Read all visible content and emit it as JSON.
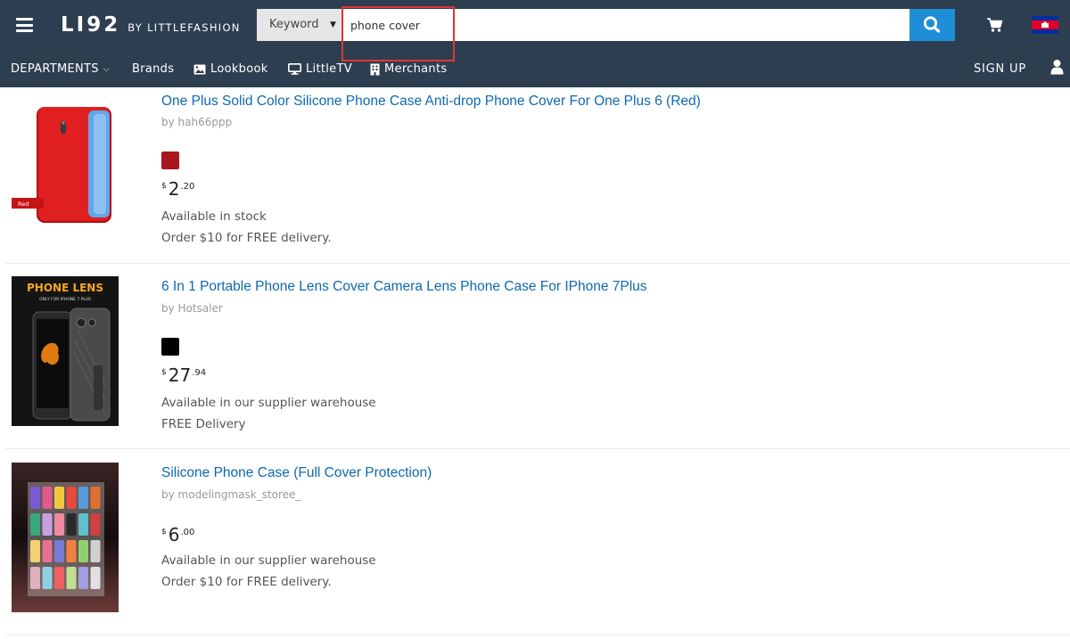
{
  "header": {
    "logo_main": "LI92",
    "logo_sub": "BY LITTLEFASHION",
    "search": {
      "scope_label": "Keyword",
      "query": "phone cover"
    },
    "flag": "cambodia-flag"
  },
  "nav": {
    "departments": "DEPARTMENTS",
    "brands": "Brands",
    "lookbook": "Lookbook",
    "littletv": "LittleTV",
    "merchants": "Merchants",
    "signup": "SIGN UP"
  },
  "products": [
    {
      "title": "One Plus Solid Color Silicone Phone Case Anti-drop Phone Cover For One Plus 6 (Red)",
      "seller": "by hah66ppp",
      "swatch_color": "#a8161e",
      "price_currency": "$",
      "price_int": "2",
      "price_dec": ".20",
      "stock": "Available in stock",
      "delivery": "Order $10 for FREE delivery.",
      "image_tag": "Red"
    },
    {
      "title": "6 In 1 Portable Phone Lens Cover Camera Lens Phone Case For IPhone 7Plus",
      "seller": "by Hotsaler",
      "swatch_color": "#000000",
      "price_currency": "$",
      "price_int": "27",
      "price_dec": ".94",
      "stock": "Available in our supplier warehouse",
      "delivery": "FREE Delivery",
      "image_title": "PHONE LENS",
      "image_subtitle": "ONLY FOR IPHONE 7 PLUS"
    },
    {
      "title": "Silicone Phone Case (Full Cover Protection)",
      "seller": "by modelingmask_storee_",
      "price_currency": "$",
      "price_int": "6",
      "price_dec": ".00",
      "stock": "Available in our supplier warehouse",
      "delivery": "Order $10 for FREE delivery."
    }
  ]
}
